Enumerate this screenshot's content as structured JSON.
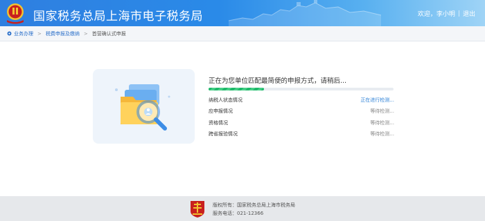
{
  "header": {
    "title": "国家税务总局上海市电子税务局",
    "greeting": "欢迎，李小明",
    "separator": "|",
    "logout": "退出"
  },
  "breadcrumb": {
    "items": [
      "业务办理",
      "税费申报及缴纳",
      "首营确认式申报"
    ],
    "separator": ">"
  },
  "status": {
    "title": "正在为您单位匹配最简便的申报方式，请稍后...",
    "progress": 0.3,
    "checks": [
      {
        "name": "纳税人状态情况",
        "state": "正在进行检测...",
        "active": true
      },
      {
        "name": "应申报情况",
        "state": "等待检测...",
        "active": false
      },
      {
        "name": "资格情况",
        "state": "等待检测...",
        "active": false
      },
      {
        "name": "跨省报验情况",
        "state": "等待检测...",
        "active": false
      }
    ]
  },
  "footer": {
    "copyright": "版权所有：国家税务总局上海市税务局",
    "phone": "服务电话：021-12366"
  },
  "colors": {
    "brand_blue": "#2a7fd6",
    "progress_green": "#1fb86a",
    "emblem_red": "#c8201e",
    "emblem_gold": "#f2c230"
  }
}
